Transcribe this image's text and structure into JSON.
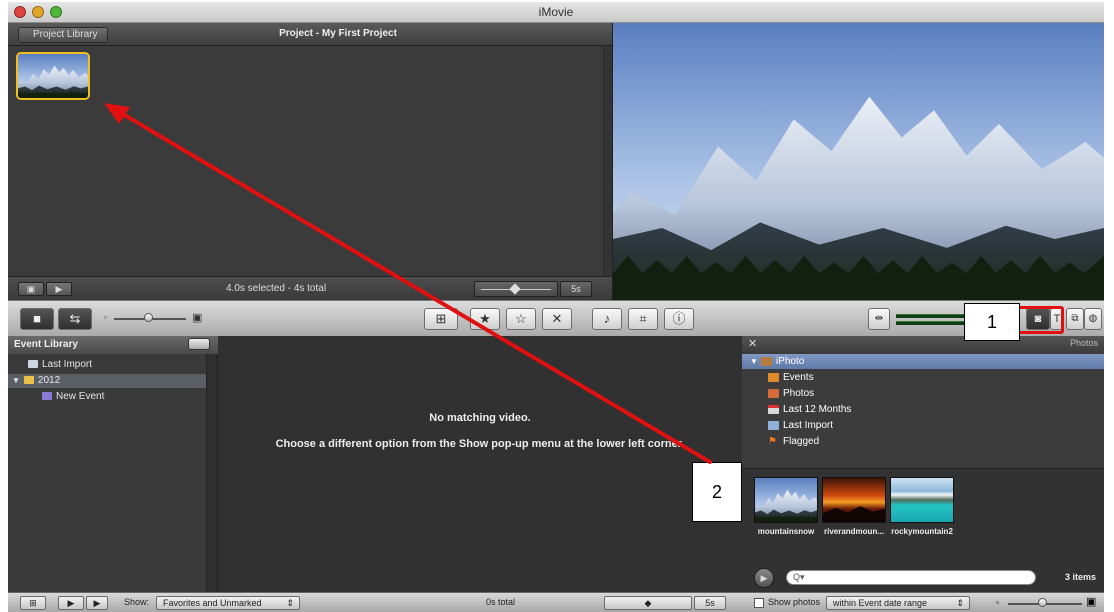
{
  "window": {
    "title": "iMovie"
  },
  "project": {
    "library_button": "Project Library",
    "title": "Project - My First Project",
    "status": "4.0s selected - 4s total",
    "zoom_value": "5s"
  },
  "event_library": {
    "title": "Event Library",
    "items": [
      {
        "label": "Last Import",
        "icon": "film-icon"
      },
      {
        "label": "2012",
        "icon": "calendar-icon"
      },
      {
        "label": "New Event",
        "icon": "star-icon"
      }
    ]
  },
  "browser": {
    "message_title": "No matching video.",
    "message_body": "Choose a different option from the Show pop-up menu at the lower left corner."
  },
  "photos": {
    "panel_title": "Photos",
    "close": "✕",
    "sources": [
      {
        "label": "iPhoto",
        "icon": "iphoto-icon"
      },
      {
        "label": "Events",
        "icon": "events-icon"
      },
      {
        "label": "Photos",
        "icon": "photos-icon"
      },
      {
        "label": "Last 12 Months",
        "icon": "calendar-icon"
      },
      {
        "label": "Last Import",
        "icon": "import-icon"
      },
      {
        "label": "Flagged",
        "icon": "flag-icon"
      }
    ],
    "thumbnails": [
      {
        "caption": "mountainsnow"
      },
      {
        "caption": "riverandmoun..."
      },
      {
        "caption": "rockymountain2"
      }
    ],
    "search_placeholder": "Q▾",
    "count": "3 items"
  },
  "bottom": {
    "show_label": "Show:",
    "show_value": "Favorites and Unmarked",
    "total": "0s total",
    "zoom_value": "5s",
    "show_photos_label": "Show photos",
    "date_range_value": "within Event date range"
  },
  "annotations": {
    "callout_1": "1",
    "callout_2": "2"
  },
  "colors": {
    "selection_yellow": "#f0c020",
    "annotation_red": "#e01010",
    "source_selected": "#6f88b6"
  }
}
